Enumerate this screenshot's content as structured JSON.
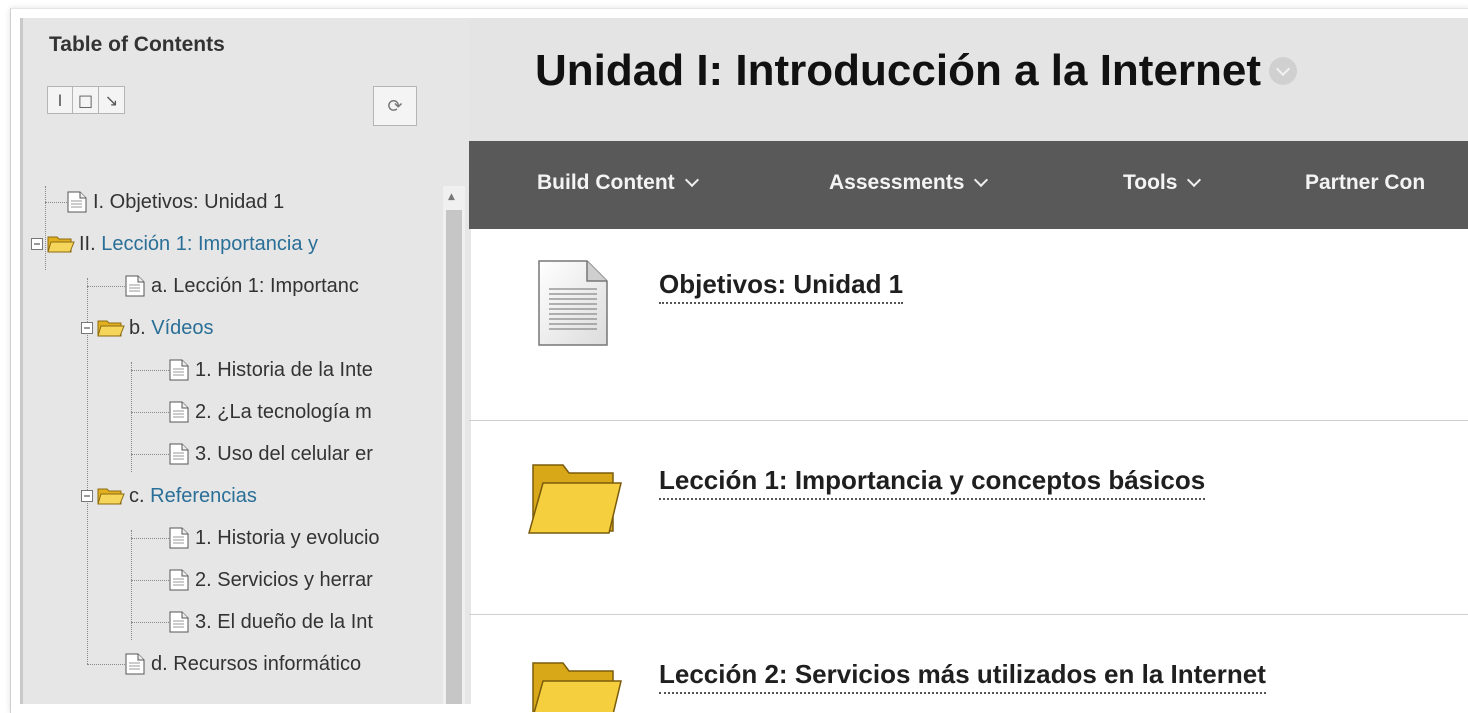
{
  "sidebar": {
    "title": "Table of Contents",
    "toolbar_buttons": [
      {
        "icon": "expand-line-icon",
        "glyph": "I"
      },
      {
        "icon": "collapse-square-icon",
        "glyph": "□"
      },
      {
        "icon": "arrow-down-right-icon",
        "glyph": "↘"
      }
    ],
    "refresh": {
      "icon": "refresh-icon",
      "glyph": "⟳"
    },
    "tree": [
      {
        "prefix": "I. ",
        "label": "Objetivos: Unidad 1",
        "type": "document"
      },
      {
        "prefix": "II. ",
        "label": "Lección 1: Importancia y",
        "type": "folder",
        "expanded": true
      },
      {
        "prefix": "a. ",
        "label": "Lección 1: Importanc",
        "type": "document"
      },
      {
        "prefix": "b. ",
        "label": "Vídeos",
        "type": "folder",
        "expanded": true
      },
      {
        "prefix": "1. ",
        "label": "Historia de la Inte",
        "type": "document"
      },
      {
        "prefix": "2. ",
        "label": "¿La tecnología m",
        "type": "document"
      },
      {
        "prefix": "3. ",
        "label": "Uso del celular er",
        "type": "document"
      },
      {
        "prefix": "c. ",
        "label": "Referencias",
        "type": "folder",
        "expanded": true
      },
      {
        "prefix": "1. ",
        "label": "Historia y evolucio",
        "type": "document"
      },
      {
        "prefix": "2. ",
        "label": "Servicios y herrar",
        "type": "document"
      },
      {
        "prefix": "3. ",
        "label": "El dueño de la Int",
        "type": "document"
      },
      {
        "prefix": "d. ",
        "label": "Recursos informático",
        "type": "document"
      }
    ]
  },
  "header": {
    "title": "Unidad I: Introducción a la Internet"
  },
  "action_bar": {
    "items": [
      {
        "label": "Build Content",
        "has_chevron": true
      },
      {
        "label": "Assessments",
        "has_chevron": true
      },
      {
        "label": "Tools",
        "has_chevron": true
      },
      {
        "label": "Partner Con",
        "has_chevron": false
      }
    ]
  },
  "content_items": [
    {
      "title": "Objetivos: Unidad 1",
      "icon": "document-icon"
    },
    {
      "title": "Lección 1: Importancia y conceptos básicos",
      "icon": "folder-icon"
    },
    {
      "title": "Lección 2: Servicios más utilizados en la Internet",
      "icon": "folder-icon"
    }
  ],
  "colors": {
    "sidebar_bg": "#e6e6e6",
    "header_bg": "#e4e4e4",
    "action_bar_bg": "#595959",
    "link": "#2a6f97",
    "folder": "#f2c631"
  }
}
